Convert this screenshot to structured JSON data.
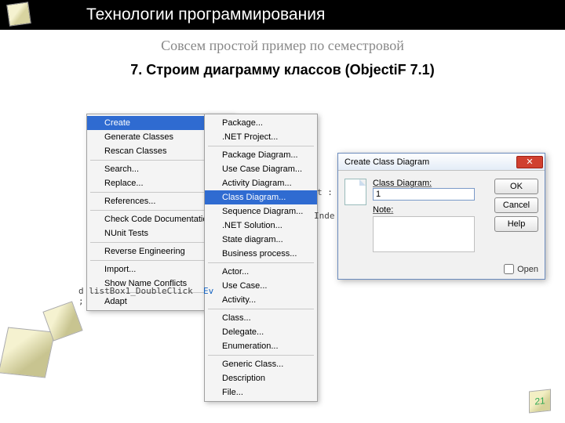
{
  "header": {
    "title": "Технологии программирования"
  },
  "subtitle": "Совсем простой пример по семестровой",
  "step_title": "7. Строим диаграмму классов (ObjectiF 7.1)",
  "menu1": {
    "items": [
      {
        "label": "Create",
        "sel": true,
        "arrow": true
      },
      {
        "label": "Generate Classes"
      },
      {
        "label": "Rescan Classes"
      },
      {
        "sep": true
      },
      {
        "label": "Search..."
      },
      {
        "label": "Replace..."
      },
      {
        "sep": true
      },
      {
        "label": "References..."
      },
      {
        "sep": true
      },
      {
        "label": "Check Code Documentation..."
      },
      {
        "label": "NUnit Tests",
        "arrow": true
      },
      {
        "sep": true
      },
      {
        "label": "Reverse Engineering",
        "arrow": true
      },
      {
        "sep": true
      },
      {
        "label": "Import..."
      },
      {
        "label": "Show Name Conflicts"
      },
      {
        "sep": true
      },
      {
        "label": "Adapt",
        "arrow": true
      }
    ]
  },
  "menu2": {
    "items": [
      {
        "label": "Package..."
      },
      {
        "label": ".NET Project..."
      },
      {
        "sep": true
      },
      {
        "label": "Package Diagram..."
      },
      {
        "label": "Use Case Diagram..."
      },
      {
        "label": "Activity Diagram..."
      },
      {
        "label": "Class Diagram...",
        "sel": true
      },
      {
        "label": "Sequence Diagram..."
      },
      {
        "label": ".NET Solution..."
      },
      {
        "label": "State diagram..."
      },
      {
        "label": "Business process..."
      },
      {
        "sep": true
      },
      {
        "label": "Actor..."
      },
      {
        "label": "Use Case..."
      },
      {
        "label": "Activity..."
      },
      {
        "sep": true
      },
      {
        "label": "Class..."
      },
      {
        "label": "Delegate..."
      },
      {
        "label": "Enumeration..."
      },
      {
        "sep": true
      },
      {
        "label": "Generic Class..."
      },
      {
        "label": "Description"
      },
      {
        "label": "File..."
      }
    ]
  },
  "dialog": {
    "title": "Create Class Diagram",
    "label_classdiagram": "Class Diagram:",
    "input_value": "1",
    "label_note": "Note:",
    "note_value": "",
    "btn_ok": "OK",
    "btn_cancel": "Cancel",
    "btn_help": "Help",
    "open_label": "Open"
  },
  "code": {
    "line1": "d listBox1_DoubleClick",
    "line1_tail": "  Ev",
    "frag_right1": "t :",
    "frag_right2": "Inde",
    "line2": ";"
  },
  "page_number": "21"
}
